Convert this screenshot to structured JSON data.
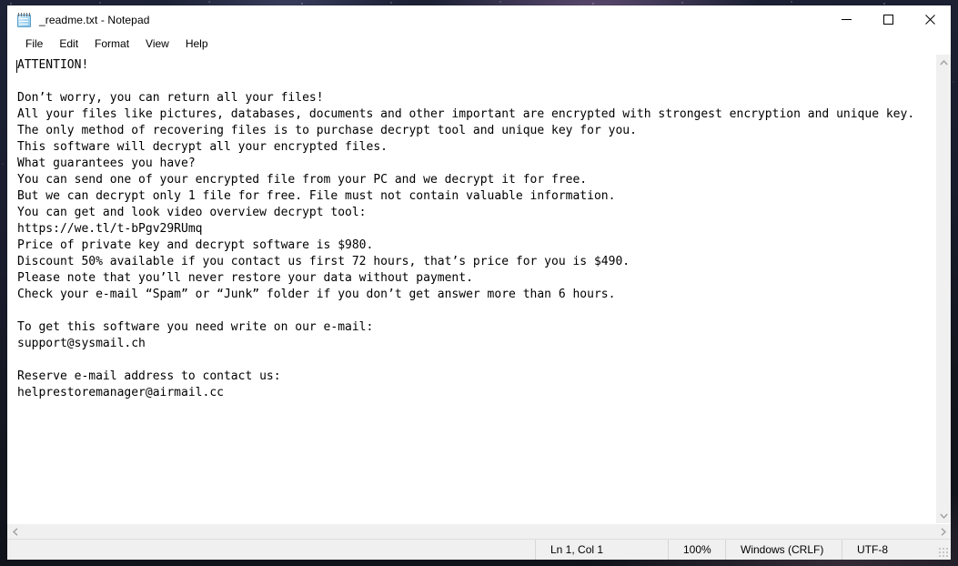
{
  "window": {
    "title": "_readme.txt - Notepad",
    "icon": "notepad-icon",
    "controls": {
      "minimize": "Minimize",
      "maximize": "Maximize",
      "close": "Close"
    }
  },
  "menu": {
    "items": [
      {
        "label": "File"
      },
      {
        "label": "Edit"
      },
      {
        "label": "Format"
      },
      {
        "label": "View"
      },
      {
        "label": "Help"
      }
    ]
  },
  "editor": {
    "content": "ATTENTION!\n\nDon’t worry, you can return all your files!\nAll your files like pictures, databases, documents and other important are encrypted with strongest encryption and unique key.\nThe only method of recovering files is to purchase decrypt tool and unique key for you.\nThis software will decrypt all your encrypted files.\nWhat guarantees you have?\nYou can send one of your encrypted file from your PC and we decrypt it for free.\nBut we can decrypt only 1 file for free. File must not contain valuable information.\nYou can get and look video overview decrypt tool:\nhttps://we.tl/t-bPgv29RUmq\nPrice of private key and decrypt software is $980.\nDiscount 50% available if you contact us first 72 hours, that’s price for you is $490.\nPlease note that you’ll never restore your data without payment.\nCheck your e-mail “Spam” or “Junk” folder if you don’t get answer more than 6 hours.\n\nTo get this software you need write on our e-mail:\nsupport@sysmail.ch\n\nReserve e-mail address to contact us:\nhelprestoremanager@airmail.cc",
    "lines": [
      "ATTENTION!",
      "",
      "Don’t worry, you can return all your files!",
      "All your files like pictures, databases, documents and other important are encrypted with strongest encryption and unique key.",
      "The only method of recovering files is to purchase decrypt tool and unique key for you.",
      "This software will decrypt all your encrypted files.",
      "What guarantees you have?",
      "You can send one of your encrypted file from your PC and we decrypt it for free.",
      "But we can decrypt only 1 file for free. File must not contain valuable information.",
      "You can get and look video overview decrypt tool:",
      "https://we.tl/t-bPgv29RUmq",
      "Price of private key and decrypt software is $980.",
      "Discount 50% available if you contact us first 72 hours, that’s price for you is $490.",
      "Please note that you’ll never restore your data without payment.",
      "Check your e-mail “Spam” or “Junk” folder if you don’t get answer more than 6 hours.",
      "",
      "To get this software you need write on our e-mail:",
      "support@sysmail.ch",
      "",
      "Reserve e-mail address to contact us:",
      "helprestoremanager@airmail.cc"
    ],
    "ransom_details": {
      "video_url": "https://we.tl/t-bPgv29RUmq",
      "price": "$980",
      "discount_price": "$490",
      "discount_percent": "50%",
      "discount_window_hours": "72",
      "reply_window_hours": "6",
      "primary_email": "support@sysmail.ch",
      "reserve_email": "helprestoremanager@airmail.cc"
    }
  },
  "scrollbars": {
    "vertical": {
      "up_arrow": "▲",
      "down_arrow": "▼"
    },
    "horizontal": {
      "left_arrow": "◀",
      "right_arrow": "▶"
    }
  },
  "statusbar": {
    "position": "Ln 1, Col 1",
    "zoom": "100%",
    "line_ending": "Windows (CRLF)",
    "encoding": "UTF-8"
  },
  "colors": {
    "window_bg": "#ffffff",
    "chrome_bg": "#f0f0f0",
    "text": "#000000",
    "close_hover": "#e81123"
  }
}
